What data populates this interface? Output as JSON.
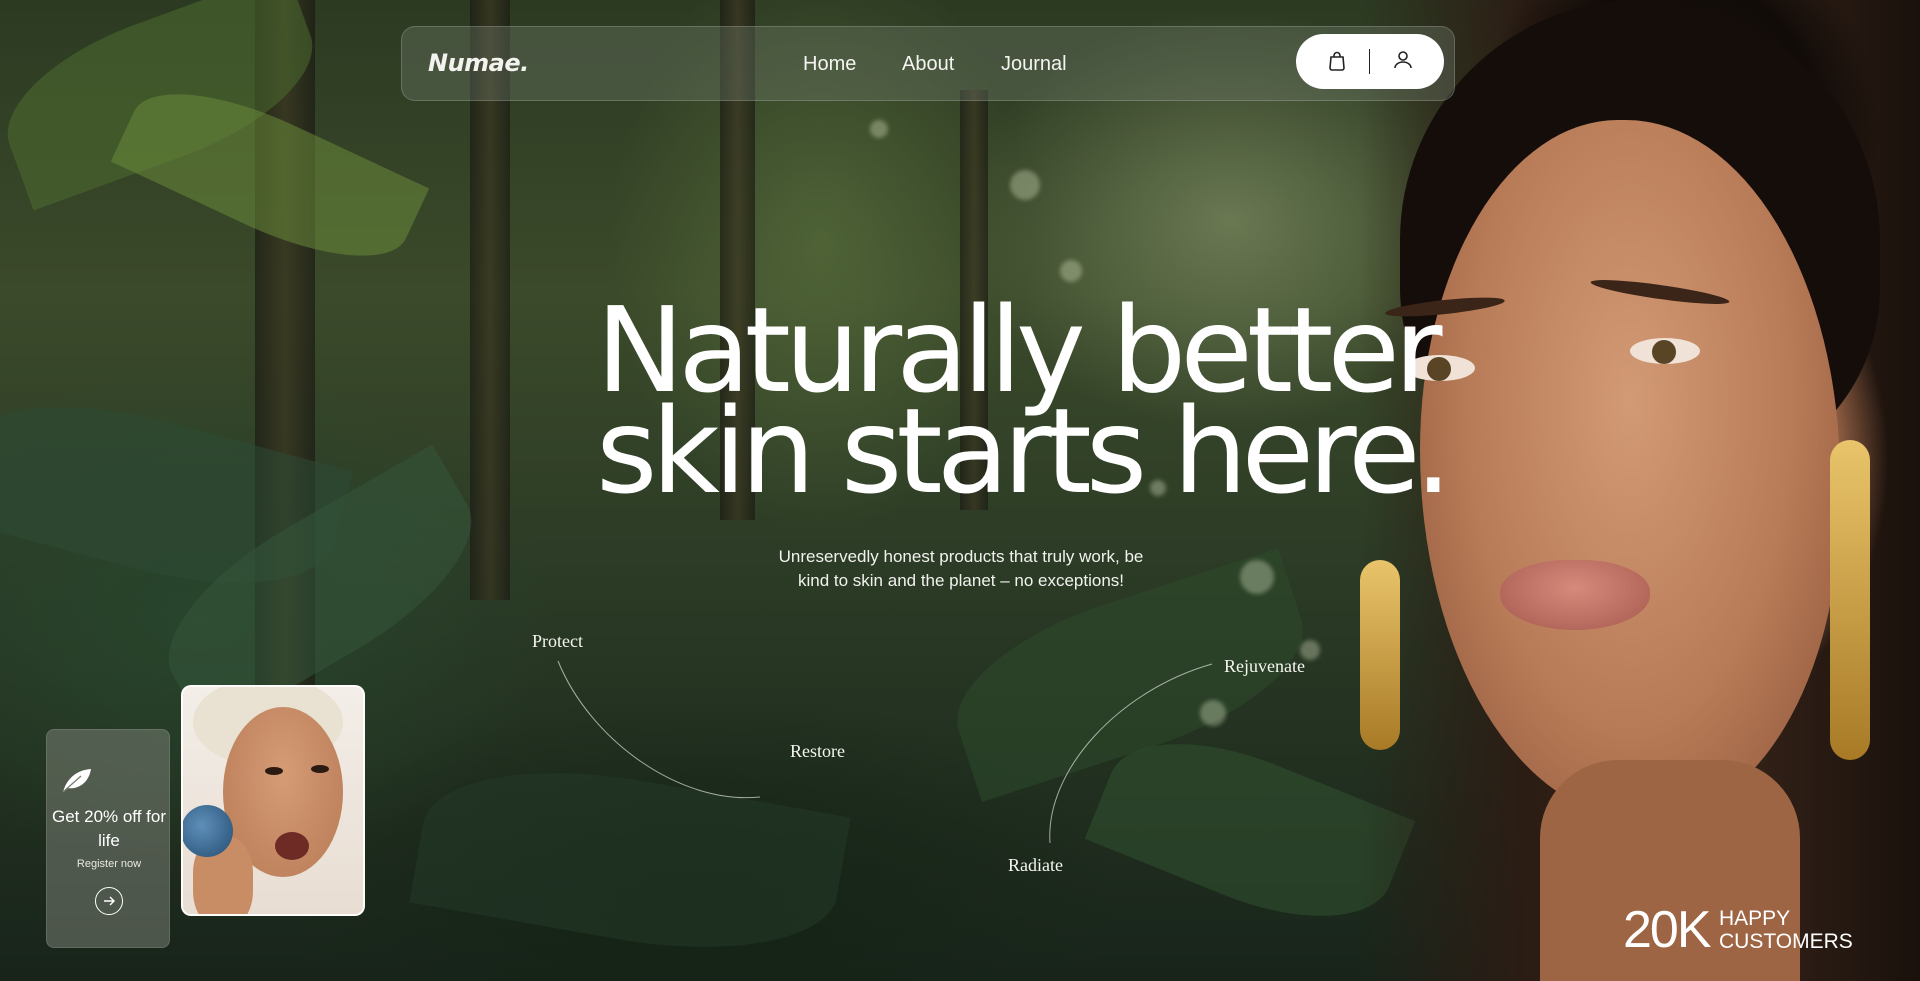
{
  "brand": {
    "logo": "Numae."
  },
  "nav": {
    "links": [
      {
        "label": "Home"
      },
      {
        "label": "About"
      },
      {
        "label": "Journal"
      }
    ],
    "actions": {
      "cart_icon": "shopping-bag-icon",
      "account_icon": "user-icon"
    }
  },
  "hero": {
    "title_line1": "Naturally better",
    "title_line2": "skin starts here.",
    "subtitle": "Unreservedly honest products that truly work, be kind to skin and the planet – no exceptions!",
    "benefits": [
      "Protect",
      "Restore",
      "Radiate",
      "Rejuvenate"
    ]
  },
  "promo": {
    "icon": "leaf-icon",
    "title": "Get 20% off for life",
    "link": "Register now",
    "arrow_icon": "arrow-right-circle-icon"
  },
  "stat": {
    "value": "20K",
    "label_line1": "HAPPY",
    "label_line2": "CUSTOMERS"
  },
  "colors": {
    "text": "#ffffff",
    "nav_glass": "#6e7869",
    "action_pill": "#ffffff"
  }
}
